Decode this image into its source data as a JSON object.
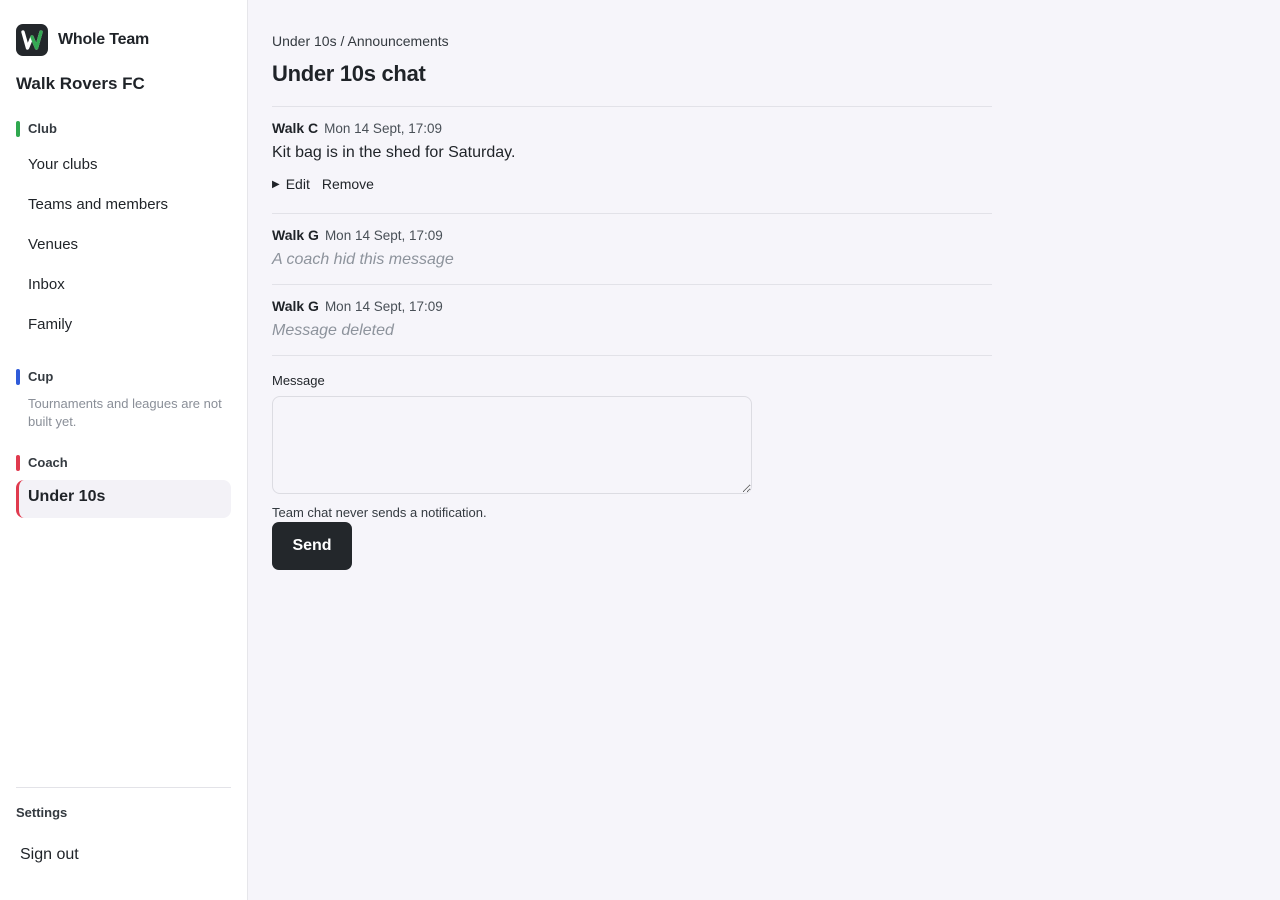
{
  "app": {
    "name": "Whole Team",
    "logo_letter": "W",
    "accent_green": "#34a853"
  },
  "sidebar": {
    "club_name": "Walk Rovers FC",
    "sections": {
      "club": {
        "label": "Club",
        "color": "#2fa84f",
        "items": [
          "Your clubs",
          "Teams and members",
          "Venues",
          "Inbox",
          "Family"
        ]
      },
      "cup": {
        "label": "Cup",
        "color": "#2f5bd9",
        "note": "Tournaments and leagues are not built yet."
      },
      "coach": {
        "label": "Coach",
        "color": "#e03a4e",
        "items": [
          "Under 10s"
        ],
        "active_item": "Under 10s"
      }
    },
    "settings_label": "Settings",
    "sign_out": "Sign out"
  },
  "breadcrumb": {
    "team": "Under 10s",
    "separator": "/",
    "page": "Announcements"
  },
  "page_title": "Under 10s chat",
  "messages": [
    {
      "author": "Walk C",
      "time": "Mon 14 Sept, 17:09",
      "body": "Kit bag is in the shed for Saturday.",
      "actions": {
        "edit": "Edit",
        "remove": "Remove"
      }
    },
    {
      "author": "Walk G",
      "time": "Mon 14 Sept, 17:09",
      "status": "A coach hid this message"
    },
    {
      "author": "Walk G",
      "time": "Mon 14 Sept, 17:09",
      "status": "Message deleted"
    }
  ],
  "composer": {
    "label": "Message",
    "value": "",
    "hint": "Team chat never sends a notification.",
    "send": "Send"
  }
}
